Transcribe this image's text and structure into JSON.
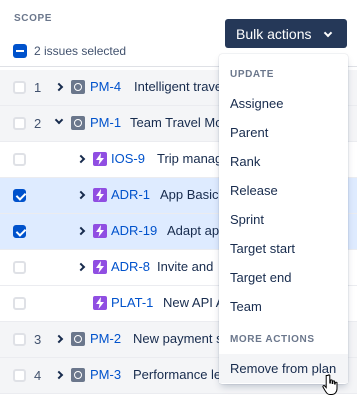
{
  "scope": {
    "title": "SCOPE",
    "selected_text": "2 issues selected",
    "bulk_button_label": "Bulk actions"
  },
  "rows": [
    {
      "num": "1",
      "key": "PM-4",
      "summary": "Intelligent travel",
      "type": "epic",
      "checked": false
    },
    {
      "num": "2",
      "key": "PM-1",
      "summary": "Team Travel Mo",
      "type": "epic",
      "checked": false
    },
    {
      "num": "",
      "key": "IOS-9",
      "summary": "Trip manag",
      "type": "story",
      "checked": false
    },
    {
      "num": "",
      "key": "ADR-1",
      "summary": "App Basic",
      "type": "story",
      "checked": true
    },
    {
      "num": "",
      "key": "ADR-19",
      "summary": "Adapt ap",
      "type": "story",
      "checked": true
    },
    {
      "num": "",
      "key": "ADR-8",
      "summary": "Invite and",
      "type": "story",
      "checked": false
    },
    {
      "num": "",
      "key": "PLAT-1",
      "summary": "New API A",
      "type": "story",
      "checked": false
    },
    {
      "num": "3",
      "key": "PM-2",
      "summary": "New payment s",
      "type": "epic",
      "checked": false
    },
    {
      "num": "4",
      "key": "PM-3",
      "summary": "Performance le",
      "type": "epic",
      "checked": false
    }
  ],
  "menu": {
    "update_label": "UPDATE",
    "update_items": [
      "Assignee",
      "Parent",
      "Rank",
      "Release",
      "Sprint",
      "Target start",
      "Target end",
      "Team"
    ],
    "more_label": "MORE ACTIONS",
    "more_items": [
      "Remove from plan"
    ]
  },
  "colors": {
    "primary": "#0052cc",
    "button_bg": "#253858",
    "selected_row": "#deebff",
    "epic_icon": "#6b778c",
    "story_icon": "#904ee2"
  },
  "icons": {
    "epic": "epic-issue-icon",
    "story": "story-lightning-icon",
    "chevron": "chevron-down-icon",
    "cursor": "hand-pointer-cursor-icon"
  }
}
